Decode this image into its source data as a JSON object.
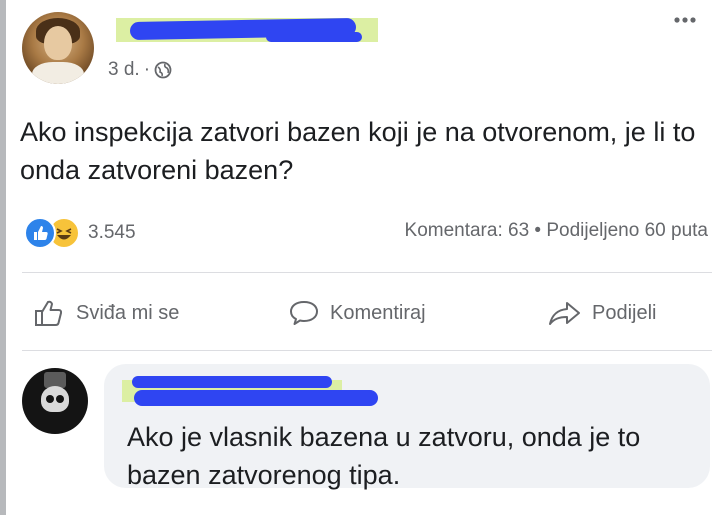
{
  "header": {
    "time": "3 d.",
    "separator": "·",
    "more_icon": "more-horizontal-icon"
  },
  "post": {
    "text": "Ako inspekcija zatvori bazen koji je na otvorenom, je li to onda zatvoreni bazen?"
  },
  "stats": {
    "reaction_icons": [
      "like-reaction-icon",
      "haha-reaction-icon"
    ],
    "reaction_count": "3.545",
    "comments_label": "Komentara: 63 • Podijeljeno 60 puta"
  },
  "actions": {
    "like_label": "Sviđa mi se",
    "comment_label": "Komentiraj",
    "share_label": "Podijeli"
  },
  "comment": {
    "text": "Ako je vlasnik bazena u zatvoru, onda je to bazen zatvorenog tipa."
  },
  "colors": {
    "reaction_like": "#2d83ea",
    "reaction_haha": "#f7c33a",
    "redaction_scribble": "#2f45f2",
    "highlight": "#dcefa3",
    "secondary_text": "#65676b"
  }
}
